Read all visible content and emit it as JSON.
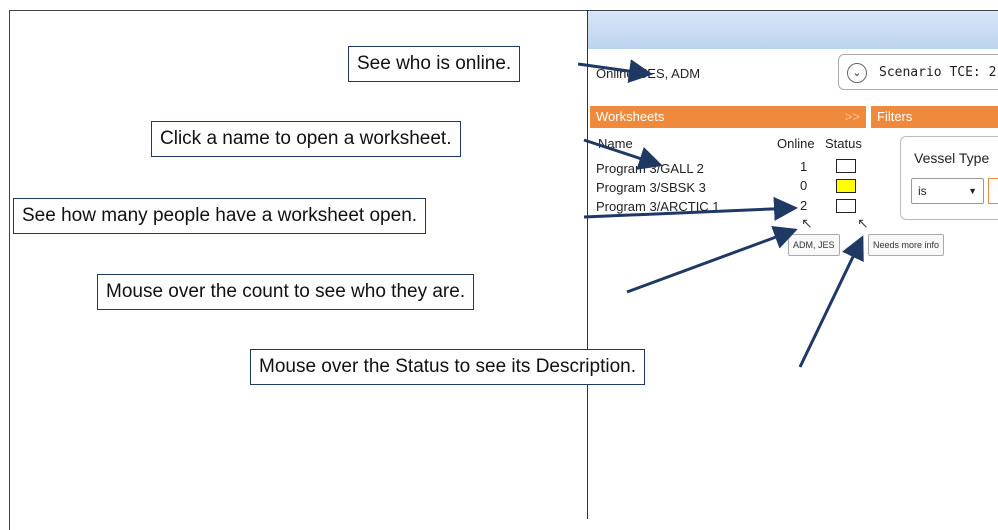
{
  "app": {
    "online_label": "Online: JES, ADM",
    "scenario_label": "Scenario TCE: 2",
    "worksheets_title": "Worksheets",
    "worksheets_collapse": ">>",
    "filters_title": "Filters",
    "col_name": "Name",
    "col_online": "Online",
    "col_status": "Status",
    "rows": [
      {
        "name": "Program 3/GALL 2",
        "count": "1",
        "status_color": "#ffffff"
      },
      {
        "name": "Program 3/SBSK 3",
        "count": "0",
        "status_color": "#ffff00"
      },
      {
        "name": "Program 3/ARCTIC 1",
        "count": "2",
        "status_color": "#ffffff"
      }
    ],
    "tooltip_count": "ADM, JES",
    "tooltip_status": "Needs more info",
    "vessel_type_label": "Vessel Type",
    "operator_value": "is"
  },
  "callouts": {
    "online": "See who is online.",
    "open_worksheet": "Click a name to open a worksheet.",
    "people_count": "See how many people have a worksheet open.",
    "mouse_count": "Mouse over the count to see who they are.",
    "mouse_status": "Mouse over the Status to see its Description."
  },
  "colors": {
    "accent": "#ef8a3c",
    "callout_border": "#1f3864",
    "arrow": "#1f3864"
  }
}
